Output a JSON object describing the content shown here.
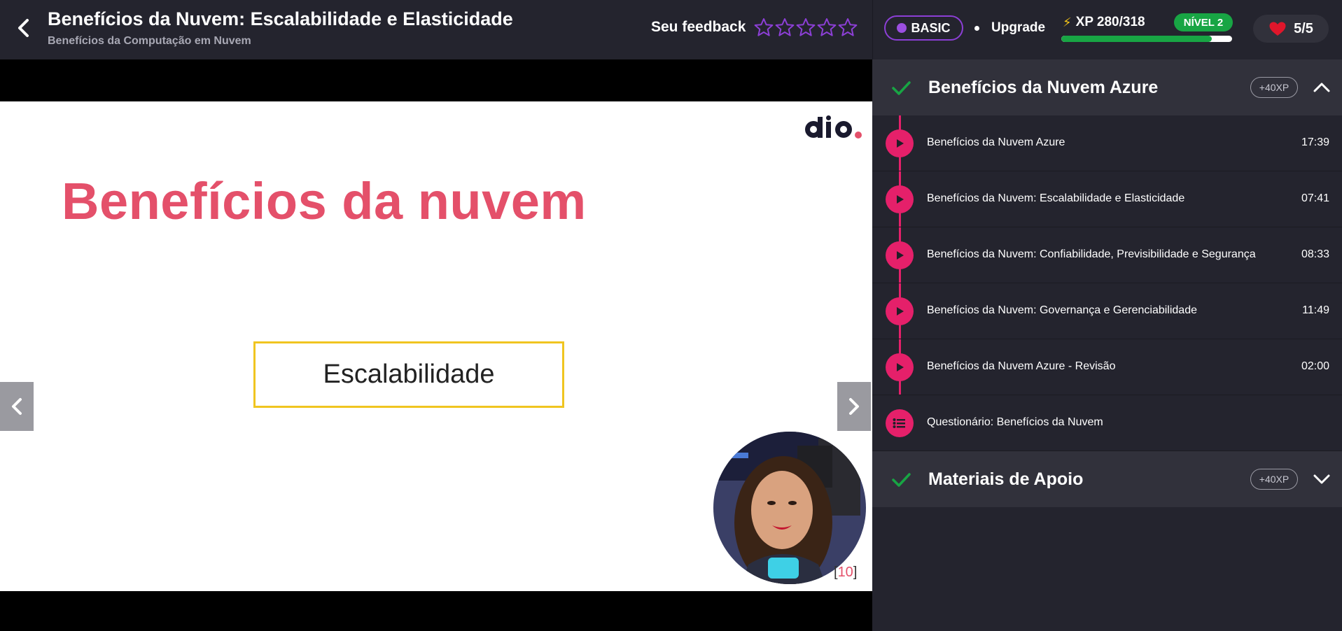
{
  "header": {
    "title": "Benefícios da Nuvem: Escalabilidade e Elasticidade",
    "subtitle": "Benefícios da Computação em Nuvem",
    "feedback_label": "Seu feedback",
    "stars_count": 5,
    "plan_badge": "BASIC",
    "upgrade_label": "Upgrade",
    "xp_label": "XP 280/318",
    "xp_current": 280,
    "xp_total": 318,
    "level_label": "NÍVEL 2",
    "lives_label": "5/5",
    "colors": {
      "accent_purple": "#8c3fd6",
      "level_green": "#18a544",
      "heart_red": "#e0162b"
    }
  },
  "slide": {
    "title": "Benefícios da nuvem",
    "box_text": "Escalabilidade",
    "page_ref_open": "[",
    "page_ref_num": "10",
    "page_ref_close": "]",
    "logo_icon": "dio-logo"
  },
  "sidebar": {
    "sections": [
      {
        "title": "Benefícios da Nuvem Azure",
        "xp": "+40XP",
        "expanded": true
      },
      {
        "title": "Materiais de Apoio",
        "xp": "+40XP",
        "expanded": false
      }
    ],
    "lessons": [
      {
        "name": "Benefícios da Nuvem Azure",
        "duration": "17:39",
        "icon": "play-icon"
      },
      {
        "name": "Benefícios da Nuvem: Escalabilidade e Elasticidade",
        "duration": "07:41",
        "icon": "play-icon"
      },
      {
        "name": "Benefícios da Nuvem: Confiabilidade, Previsibilidade e Segurança",
        "duration": "08:33",
        "icon": "play-icon"
      },
      {
        "name": "Benefícios da Nuvem: Governança e Gerenciabilidade",
        "duration": "11:49",
        "icon": "play-icon"
      },
      {
        "name": "Benefícios da Nuvem Azure - Revisão",
        "duration": "02:00",
        "icon": "play-icon"
      },
      {
        "name": "Questionário: Benefícios da Nuvem",
        "duration": "",
        "icon": "list-icon"
      }
    ],
    "colors": {
      "timeline_pink": "#e5206a",
      "check_green": "#18a544"
    }
  }
}
